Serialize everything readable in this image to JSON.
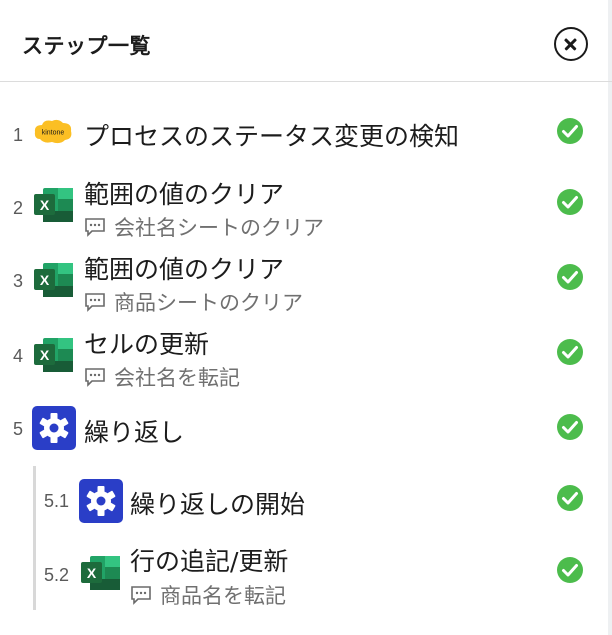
{
  "header": {
    "title": "ステップ一覧",
    "close_icon": "close-circle-icon"
  },
  "steps": [
    {
      "number": "1",
      "app": "kintone",
      "app_label": "kintone",
      "title": "プロセスのステータス変更の検知",
      "subtitle": "",
      "status": "success"
    },
    {
      "number": "2",
      "app": "excel",
      "app_label": "X",
      "title": "範囲の値のクリア",
      "subtitle": "会社名シートのクリア",
      "status": "success"
    },
    {
      "number": "3",
      "app": "excel",
      "app_label": "X",
      "title": "範囲の値のクリア",
      "subtitle": "商品シートのクリア",
      "status": "success"
    },
    {
      "number": "4",
      "app": "excel",
      "app_label": "X",
      "title": "セルの更新",
      "subtitle": "会社名を転記",
      "status": "success"
    },
    {
      "number": "5",
      "app": "loop",
      "app_label": "",
      "title": "繰り返し",
      "subtitle": "",
      "status": "success"
    },
    {
      "number": "5.1",
      "app": "loop",
      "app_label": "",
      "title": "繰り返しの開始",
      "subtitle": "",
      "status": "success"
    },
    {
      "number": "5.2",
      "app": "excel",
      "app_label": "X",
      "title": "行の追記/更新",
      "subtitle": "商品名を転記",
      "status": "success"
    }
  ],
  "colors": {
    "success": "#4cbc4c",
    "excel_dark": "#1d6b3c",
    "excel_mid": "#21a366",
    "excel_light": "#33c481",
    "kintone": "#fbbf24",
    "loop": "#2a3ec7"
  }
}
